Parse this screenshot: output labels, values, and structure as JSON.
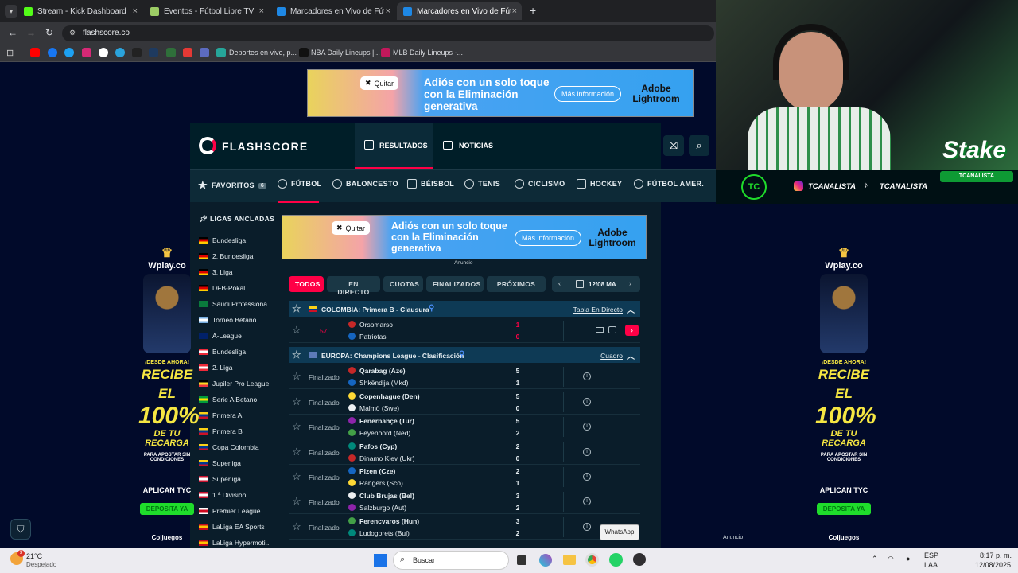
{
  "browser": {
    "tabs": [
      {
        "title": "Stream - Kick Dashboard",
        "color": "#53fc18"
      },
      {
        "title": "Eventos - Fútbol Libre TV",
        "color": "#9ccc65"
      },
      {
        "title": "Marcadores en Vivo de Fútbol,",
        "color": "#1e88e5"
      },
      {
        "title": "Marcadores en Vivo de Fútbol,",
        "color": "#1e88e5",
        "active": true
      }
    ],
    "new_tab": "+",
    "url": "flashscore.co",
    "bookmarks": [
      "Deportes en vivo, p...",
      "NBA Daily Lineups |...",
      "MLB Daily Lineups -..."
    ]
  },
  "top_ad": {
    "quitar": "Quitar",
    "headline_1": "Adiós con un solo toque",
    "headline_2": "con la Eliminación",
    "headline_3": "generativa",
    "cta": "Más información",
    "brand_1": "Adobe",
    "brand_2": "Lightroom"
  },
  "header": {
    "logo": "FLASHSCORE",
    "nav_results": "RESULTADOS",
    "nav_news": "NOTICIAS"
  },
  "sports": {
    "favorites": "FAVORITOS",
    "favorites_count": "6",
    "items": [
      "FÚTBOL",
      "BALONCESTO",
      "BÉISBOL",
      "TENIS",
      "CICLISMO",
      "HOCKEY",
      "FÚTBOL AMER."
    ]
  },
  "sidebar": {
    "title": "LIGAS ANCLADAS",
    "leagues": [
      {
        "name": "Bundesliga",
        "flag": [
          "#000",
          "#d00",
          "#fc0"
        ]
      },
      {
        "name": "2. Bundesliga",
        "flag": [
          "#000",
          "#d00",
          "#fc0"
        ]
      },
      {
        "name": "3. Liga",
        "flag": [
          "#000",
          "#d00",
          "#fc0"
        ]
      },
      {
        "name": "DFB-Pokal",
        "flag": [
          "#000",
          "#d00",
          "#fc0"
        ]
      },
      {
        "name": "Saudi Professiona...",
        "flag": [
          "#0a7a3c",
          "#0a7a3c",
          "#0a7a3c"
        ]
      },
      {
        "name": "Torneo Betano",
        "flag": [
          "#74acdf",
          "#fff",
          "#74acdf"
        ]
      },
      {
        "name": "A-League",
        "flag": [
          "#012169",
          "#012169",
          "#012169"
        ]
      },
      {
        "name": "Bundesliga",
        "flag": [
          "#ed2939",
          "#fff",
          "#ed2939"
        ]
      },
      {
        "name": "2. Liga",
        "flag": [
          "#ed2939",
          "#fff",
          "#ed2939"
        ]
      },
      {
        "name": "Jupiler Pro League",
        "flag": [
          "#000",
          "#fdda24",
          "#ef3340"
        ]
      },
      {
        "name": "Serie A Betano",
        "flag": [
          "#009c3b",
          "#ffdf00",
          "#009c3b"
        ]
      },
      {
        "name": "Primera A",
        "flag": [
          "#fcd116",
          "#003893",
          "#ce1126"
        ]
      },
      {
        "name": "Primera B",
        "flag": [
          "#fcd116",
          "#003893",
          "#ce1126"
        ]
      },
      {
        "name": "Copa Colombia",
        "flag": [
          "#fcd116",
          "#003893",
          "#ce1126"
        ]
      },
      {
        "name": "Superliga",
        "flag": [
          "#fcd116",
          "#003893",
          "#ce1126"
        ]
      },
      {
        "name": "Superliga",
        "flag": [
          "#c8102e",
          "#fff",
          "#c8102e"
        ]
      },
      {
        "name": "1.ª División",
        "flag": [
          "#c8102e",
          "#fff",
          "#c8102e"
        ]
      },
      {
        "name": "Premier League",
        "flag": [
          "#fff",
          "#cf081f",
          "#fff"
        ]
      },
      {
        "name": "LaLiga EA Sports",
        "flag": [
          "#c60b1e",
          "#ffc400",
          "#c60b1e"
        ]
      },
      {
        "name": "LaLiga Hypermoti...",
        "flag": [
          "#c60b1e",
          "#ffc400",
          "#c60b1e"
        ]
      }
    ]
  },
  "inner_ad": {
    "label": "Anuncio"
  },
  "filters": [
    "TODOS",
    "EN DIRECTO",
    "CUOTAS",
    "FINALIZADOS",
    "PRÓXIMOS"
  ],
  "date": "12/08 MA",
  "groups": [
    {
      "name": "COLOMBIA: Primera B - Clausura",
      "link": "Tabla En Directo",
      "matches": [
        {
          "status": "57'",
          "home": "Orsomarso",
          "away": "Patriotas",
          "hs": "1",
          "as": "0",
          "live": true
        }
      ]
    },
    {
      "name": "EUROPA: Champions League - Clasificación",
      "link": "Cuadro",
      "matches": [
        {
          "status": "Finalizado",
          "home": "Qarabag (Aze)",
          "away": "Shkëndija (Mkd)",
          "hs": "5",
          "as": "1",
          "winner": "home"
        },
        {
          "status": "Finalizado",
          "home": "Copenhague (Den)",
          "away": "Malmö (Swe)",
          "hs": "5",
          "as": "0",
          "winner": "home"
        },
        {
          "status": "Finalizado",
          "home": "Fenerbahçe (Tur)",
          "away": "Feyenoord (Ned)",
          "hs": "5",
          "as": "2",
          "winner": "home"
        },
        {
          "status": "Finalizado",
          "home": "Pafos (Cyp)",
          "away": "Dinamo Kiev (Ukr)",
          "hs": "2",
          "as": "0",
          "winner": "home"
        },
        {
          "status": "Finalizado",
          "home": "Plzen (Cze)",
          "away": "Rangers (Sco)",
          "hs": "2",
          "as": "1",
          "winner": "home"
        },
        {
          "status": "Finalizado",
          "home": "Club Brujas (Bel)",
          "away": "Salzburgo (Aut)",
          "hs": "3",
          "as": "2",
          "winner": "home"
        },
        {
          "status": "Finalizado",
          "home": "Ferencvaros (Hun)",
          "away": "Ludogorets (Bul)",
          "hs": "3",
          "as": "2",
          "winner": "home"
        }
      ]
    }
  ],
  "whatsapp": "WhatsApp",
  "right_ad_label": "Anuncio",
  "side_ads": {
    "brand": "Wplay.co",
    "line_1": "¡DESDE AHORA!",
    "line_2": "RECIBE EL",
    "line_3": "100%",
    "line_4": "DE TU RECARGA",
    "line_5": "PARA APOSTAR SIN CONDICIONES",
    "tyc": "APLICAN TYC",
    "cta": "DEPOSITA YA",
    "authority": "Coljuegos"
  },
  "stream": {
    "instagram": "TCANALISTA",
    "tiktok": "TCANALISTA",
    "stake": "Stake",
    "stake_code": "TCANALISTA"
  },
  "taskbar": {
    "temp": "21°C",
    "weather": "Despejado",
    "search": "Buscar",
    "lang_1": "ESP",
    "lang_2": "LAA",
    "time": "8:17 p. m.",
    "date": "12/08/2025"
  }
}
